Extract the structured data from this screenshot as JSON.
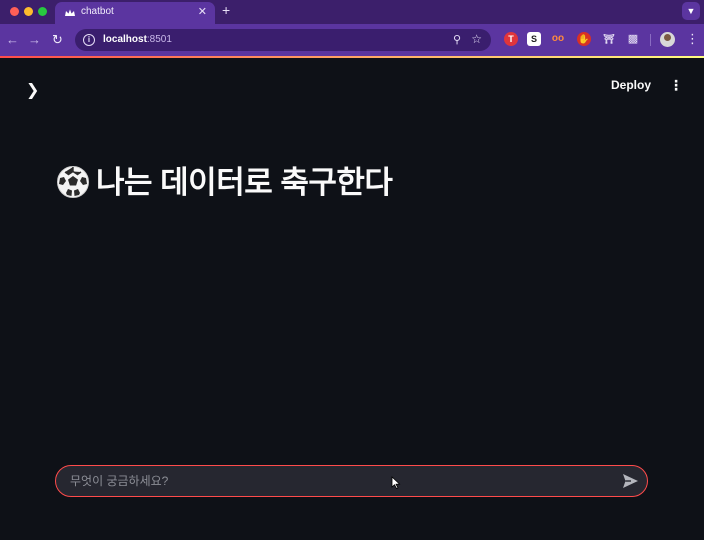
{
  "browser": {
    "tab_title": "chatbot",
    "tab_close": "✕",
    "new_tab": "+",
    "url_host": "localhost",
    "url_port": ":8501"
  },
  "app": {
    "deploy_label": "Deploy",
    "title": "나는 데이터로 축구한다",
    "chat_placeholder": "무엇이 궁금하세요?"
  },
  "colors": {
    "tab_bar": "#3c1f6b",
    "toolbar": "#5b35a0",
    "app_background": "#0e1117",
    "input_border": "#ff4b4b",
    "input_background": "#262730"
  }
}
